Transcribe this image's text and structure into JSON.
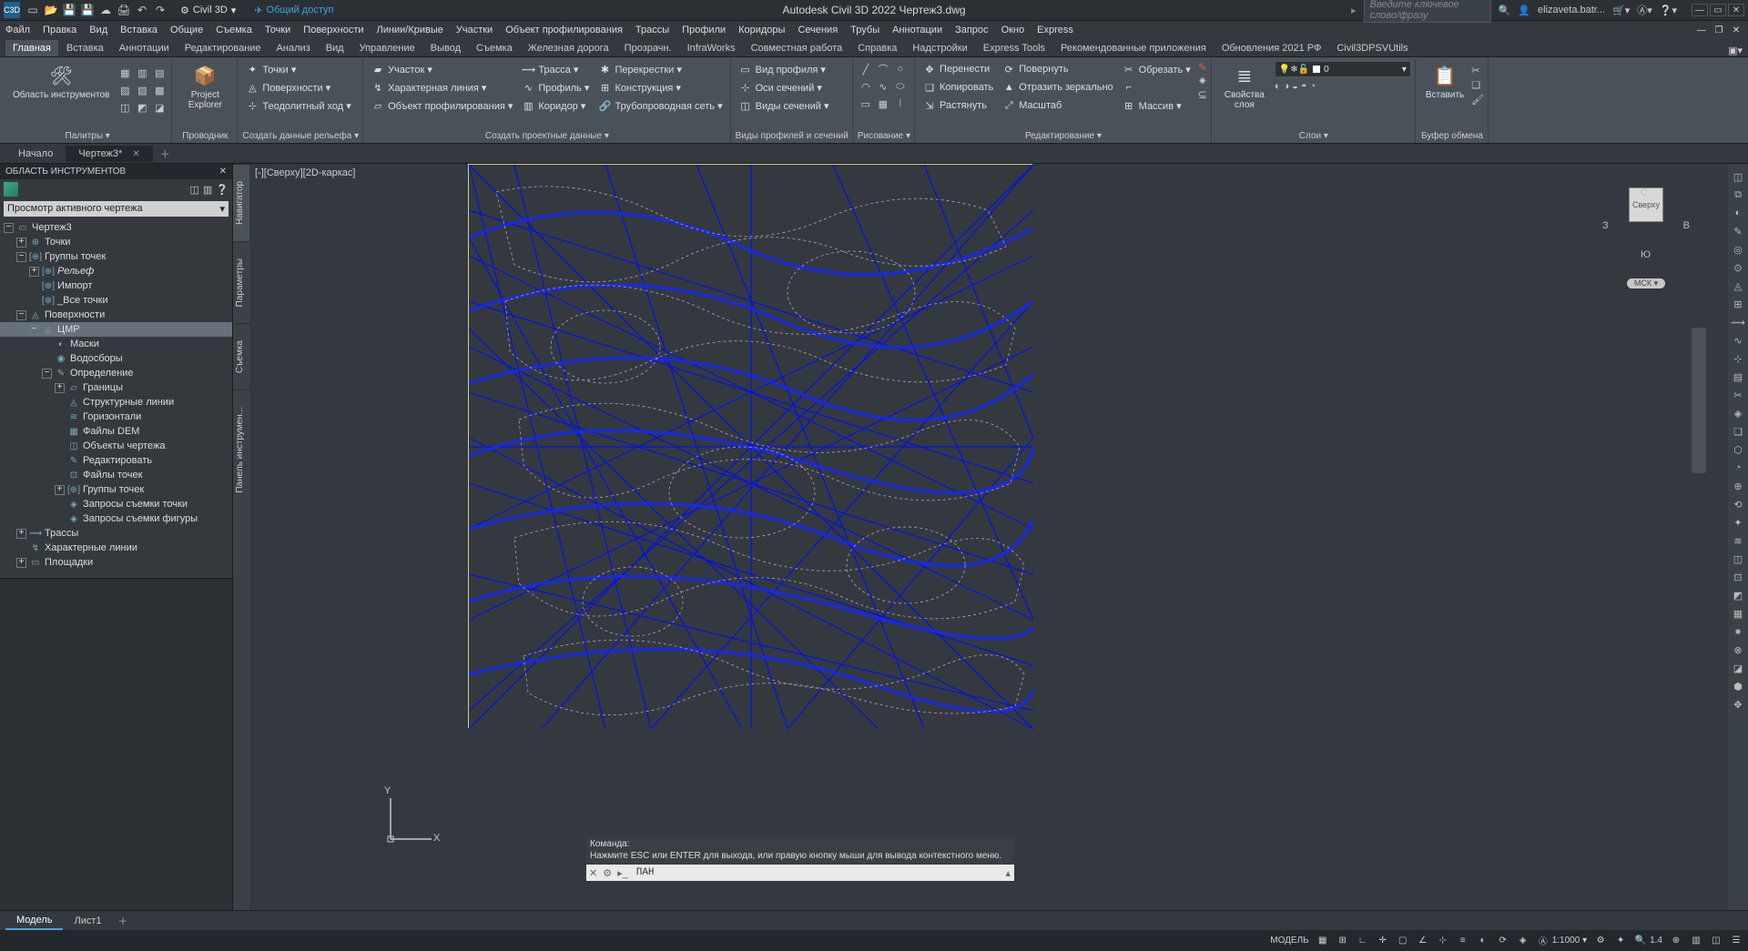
{
  "app": {
    "title": "Autodesk Civil 3D 2022   Чертеж3.dwg",
    "workspace": "Civil 3D",
    "share": "Общий доступ",
    "search_placeholder": "Введите ключевое слово/фразу",
    "user": "elizaveta.batr..."
  },
  "logo": "C3D",
  "menubar": [
    "Файл",
    "Правка",
    "Вид",
    "Вставка",
    "Общие",
    "Съемка",
    "Точки",
    "Поверхности",
    "Линии/Кривые",
    "Участки",
    "Объект профилирования",
    "Трассы",
    "Профили",
    "Коридоры",
    "Сечения",
    "Трубы",
    "Аннотации",
    "Запрос",
    "Окно",
    "Express"
  ],
  "ribbon_tabs": [
    "Главная",
    "Вставка",
    "Аннотации",
    "Редактирование",
    "Анализ",
    "Вид",
    "Управление",
    "Вывод",
    "Съемка",
    "Железная дорога",
    "Прозрачн.",
    "InfraWorks",
    "Совместная работа",
    "Справка",
    "Надстройки",
    "Express Tools",
    "Рекомендованные приложения",
    "Обновления 2021 РФ",
    "Civil3DPSVUtils"
  ],
  "ribbon_active": 0,
  "panels": {
    "palettes": {
      "title": "Палитры ▾",
      "big": "Область инструментов"
    },
    "explorer": {
      "title": "Проводник",
      "big": "Project Explorer"
    },
    "ground": {
      "title": "Создать данные рельефа ▾",
      "items": [
        "Точки ▾",
        "Поверхности ▾",
        "Теодолитный ход ▾"
      ]
    },
    "design": {
      "title": "Создать проектные данные ▾",
      "col1": [
        "Участок ▾",
        "Характерная линия ▾",
        "Объект профилирования ▾"
      ],
      "col2": [
        "Трасса ▾",
        "Профиль ▾",
        "Коридор ▾"
      ],
      "col3": [
        "Перекрестки ▾",
        "Конструкция ▾",
        "Трубопроводная сеть ▾"
      ]
    },
    "profile": {
      "title": "Виды профилей и сечений",
      "items": [
        "Вид профиля ▾",
        "Оси сечений ▾",
        "Виды сечений ▾"
      ]
    },
    "draw": {
      "title": "Рисование ▾"
    },
    "modify": {
      "title": "Редактирование ▾",
      "col1": [
        "Перенести",
        "Копировать",
        "Растянуть"
      ],
      "col2": [
        "Повернуть",
        "Отразить зеркально",
        "Масштаб"
      ],
      "col3": [
        "Обрезать ▾",
        "",
        "Массив ▾"
      ]
    },
    "layers": {
      "title": "Слои ▾",
      "big": "Свойства слоя",
      "combo": "0"
    },
    "clip": {
      "title": "Буфер обмена",
      "big": "Вставить"
    }
  },
  "file_tabs": {
    "tabs": [
      "Начало",
      "Чертеж3*"
    ],
    "active": 1
  },
  "toolspace": {
    "title": "ОБЛАСТЬ ИНСТРУМЕНТОВ",
    "combo": "Просмотр активного чертежа",
    "side_tabs": [
      "Навигатор",
      "Параметры",
      "Съемка",
      "Панель инструмен..."
    ],
    "side_active": 0
  },
  "tree": [
    {
      "lvl": 0,
      "exp": "−",
      "ico": "▭",
      "label": "Чертеж3"
    },
    {
      "lvl": 1,
      "exp": "+",
      "ico": "⊕",
      "label": "Точки"
    },
    {
      "lvl": 1,
      "exp": "−",
      "ico": "[⊕]",
      "label": "Группы точек"
    },
    {
      "lvl": 2,
      "exp": "+",
      "ico": "[⊕]",
      "label": "Рельеф",
      "italic": true
    },
    {
      "lvl": 2,
      "exp": "",
      "ico": "[⊕]",
      "label": "Импорт"
    },
    {
      "lvl": 2,
      "exp": "",
      "ico": "[⊕]",
      "label": "_Все точки"
    },
    {
      "lvl": 1,
      "exp": "−",
      "ico": "◬",
      "label": "Поверхности"
    },
    {
      "lvl": 2,
      "exp": "−",
      "ico": "◬",
      "label": "ЦМР",
      "selected": true
    },
    {
      "lvl": 3,
      "exp": "",
      "ico": "◐",
      "label": "Маски"
    },
    {
      "lvl": 3,
      "exp": "",
      "ico": "◉",
      "label": "Водосборы"
    },
    {
      "lvl": 3,
      "exp": "−",
      "ico": "✎",
      "label": "Определение"
    },
    {
      "lvl": 4,
      "exp": "+",
      "ico": "▱",
      "label": "Границы"
    },
    {
      "lvl": 4,
      "exp": "",
      "ico": "◬",
      "label": "Структурные линии"
    },
    {
      "lvl": 4,
      "exp": "",
      "ico": "≋",
      "label": "Горизонтали"
    },
    {
      "lvl": 4,
      "exp": "",
      "ico": "▦",
      "label": "Файлы DEM"
    },
    {
      "lvl": 4,
      "exp": "",
      "ico": "◫",
      "label": "Объекты чертежа"
    },
    {
      "lvl": 4,
      "exp": "",
      "ico": "✎",
      "label": "Редактировать"
    },
    {
      "lvl": 4,
      "exp": "",
      "ico": "⊡",
      "label": "Файлы точек"
    },
    {
      "lvl": 4,
      "exp": "+",
      "ico": "[⊕]",
      "label": "Группы точек"
    },
    {
      "lvl": 4,
      "exp": "",
      "ico": "◈",
      "label": "Запросы съемки точки"
    },
    {
      "lvl": 4,
      "exp": "",
      "ico": "◈",
      "label": "Запросы съемки фигуры"
    },
    {
      "lvl": 1,
      "exp": "+",
      "ico": "⟿",
      "label": "Трассы"
    },
    {
      "lvl": 1,
      "exp": "",
      "ico": "↯",
      "label": "Характерные линии"
    },
    {
      "lvl": 1,
      "exp": "+",
      "ico": "▭",
      "label": "Площадки"
    }
  ],
  "viewport": {
    "label": "[-][Сверху][2D-каркас]",
    "ucs": {
      "x": "X",
      "y": "Y"
    },
    "navcube": {
      "n": "С",
      "s": "Ю",
      "e": "В",
      "w": "З",
      "face": "Сверху",
      "wcs": "МСК ▾"
    }
  },
  "command": {
    "hist1": "Команда:",
    "hist2": "Нажмите ESC или ENTER для выхода, или правую кнопку мыши для вывода контекстного меню.",
    "current": "ПАН"
  },
  "bottom_tabs": {
    "tabs": [
      "Модель",
      "Лист1"
    ],
    "active": 0
  },
  "status": {
    "model": "МОДЕЛЬ",
    "scale": "1:1000 ▾",
    "zoom": "1.4"
  }
}
